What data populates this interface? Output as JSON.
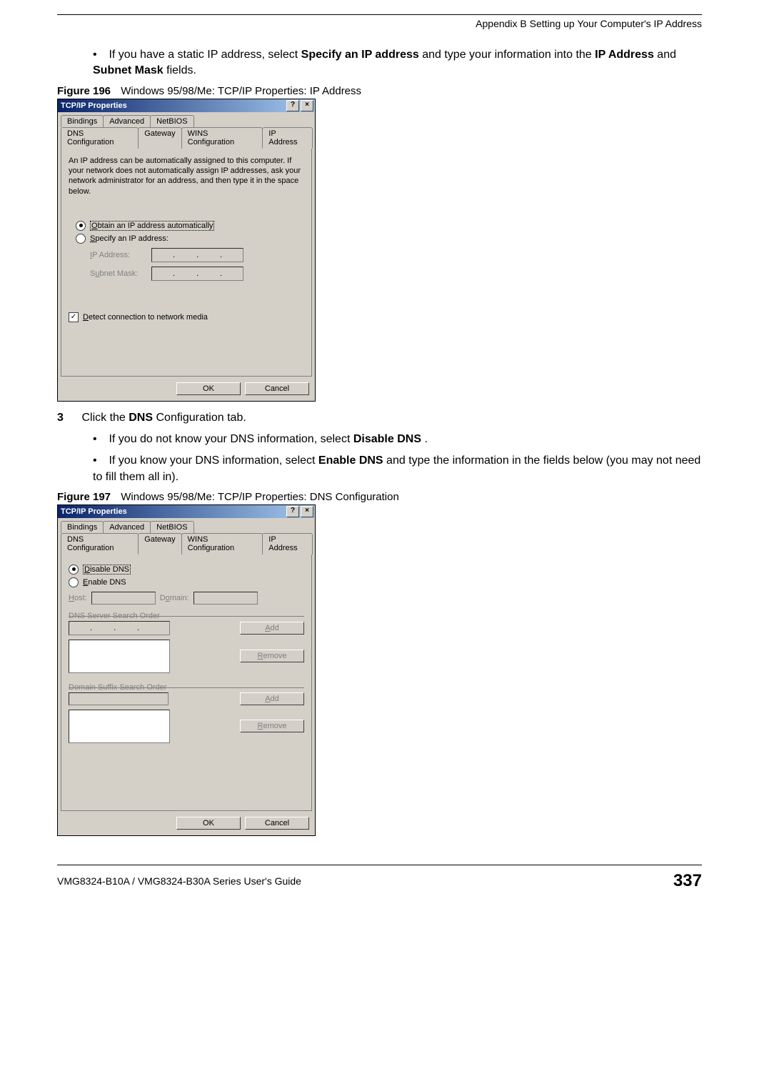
{
  "header": {
    "appendix_title": "Appendix B Setting up Your Computer's IP Address"
  },
  "intro": {
    "bullet1_pre": "If you have a static IP address, select ",
    "bullet1_b1": "Specify an IP address",
    "bullet1_mid": " and type your information into the ",
    "bullet1_b2": "IP Address",
    "bullet1_and": " and ",
    "bullet1_b3": "Subnet Mask",
    "bullet1_post": " fields."
  },
  "fig196": {
    "label": "Figure 196",
    "caption": "Windows 95/98/Me: TCP/IP Properties: IP Address"
  },
  "dlg1": {
    "title": "TCP/IP Properties",
    "help_glyph": "?",
    "close_glyph": "×",
    "tabs": {
      "bindings": "Bindings",
      "advanced": "Advanced",
      "netbios": "NetBIOS",
      "dns": "DNS Configuration",
      "gateway": "Gateway",
      "wins": "WINS Configuration",
      "ip": "IP Address"
    },
    "desc": "An IP address can be automatically assigned to this computer. If your network does not automatically assign IP addresses, ask your network administrator for an address, and then type it in the space below.",
    "radio_auto_pre": "O",
    "radio_auto": "btain an IP address automatically",
    "radio_specify_pre": "S",
    "radio_specify": "pecify an IP address:",
    "ip_label_pre": "I",
    "ip_label": "P Address:",
    "subnet_label_pre": "S",
    "subnet_label_u": "u",
    "subnet_label": "bnet Mask:",
    "detect_pre": "D",
    "detect": "etect connection to network media",
    "ok": "OK",
    "cancel": "Cancel"
  },
  "step3": {
    "num": "3",
    "pre": "Click the ",
    "b": "DNS",
    "post": " Configuration tab."
  },
  "bullets2": {
    "b1_pre": "If you do not know your DNS information, select ",
    "b1_b": "Disable DNS",
    "b1_post": ".",
    "b2_pre": "If you know your DNS information, select ",
    "b2_b": "Enable DNS",
    "b2_post": " and type the information in the fields below (you may not need to fill them all in)."
  },
  "fig197": {
    "label": "Figure 197",
    "caption": "Windows 95/98/Me: TCP/IP Properties: DNS Configuration"
  },
  "dlg2": {
    "title": "TCP/IP Properties",
    "tabs": {
      "bindings": "Bindings",
      "advanced": "Advanced",
      "netbios": "NetBIOS",
      "dns": "DNS Configuration",
      "gateway": "Gateway",
      "wins": "WINS Configuration",
      "ip": "IP Address"
    },
    "radio_disable_pre": "D",
    "radio_disable": "isable DNS",
    "radio_enable_pre": "E",
    "radio_enable": "nable DNS",
    "host_pre": "H",
    "host": "ost:",
    "domain_pre": "D",
    "domain_u": "o",
    "domain": "main:",
    "dns_order": "DNS Server Search Order",
    "domain_suffix": "Domain Suffix Search Order",
    "add_pre": "A",
    "add": "dd",
    "remove_pre": "R",
    "remove": "emove",
    "ok": "OK",
    "cancel": "Cancel"
  },
  "footer": {
    "guide": "VMG8324-B10A / VMG8324-B30A Series User's Guide",
    "page": "337"
  }
}
